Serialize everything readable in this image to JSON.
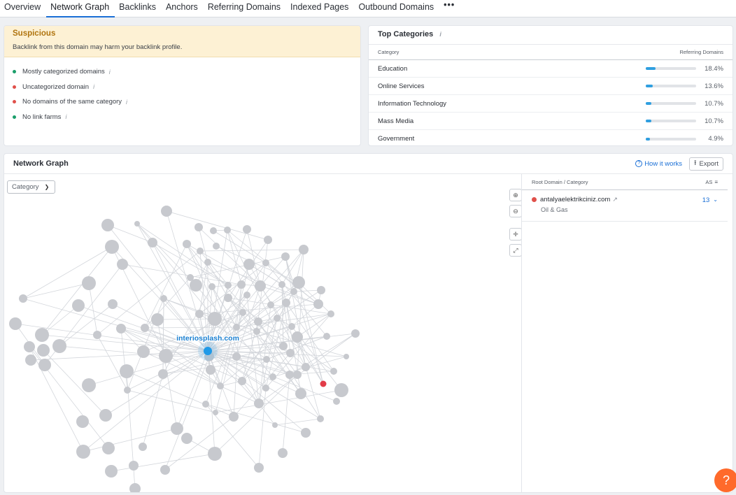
{
  "tabs": [
    {
      "label": "Overview",
      "active": false
    },
    {
      "label": "Network Graph",
      "active": true
    },
    {
      "label": "Backlinks",
      "active": false
    },
    {
      "label": "Anchors",
      "active": false
    },
    {
      "label": "Referring Domains",
      "active": false
    },
    {
      "label": "Indexed Pages",
      "active": false
    },
    {
      "label": "Outbound Domains",
      "active": false
    }
  ],
  "more_label": "•••",
  "suspicious": {
    "title": "Suspicious",
    "description": "Backlink from this domain may harm your backlink profile.",
    "items": [
      {
        "label": "Mostly categorized domains",
        "status_color": "#1a9e6a",
        "info": "i"
      },
      {
        "label": "Uncategorized domain",
        "status_color": "#e0504a",
        "info": "i"
      },
      {
        "label": "No domains of the same category",
        "status_color": "#e0504a",
        "info": "i"
      },
      {
        "label": "No link farms",
        "status_color": "#1a9e6a",
        "info": "i"
      }
    ]
  },
  "top_categories": {
    "title": "Top Categories",
    "info": "i",
    "col_category": "Category",
    "col_domains": "Referring Domains",
    "rows": [
      {
        "category": "Education",
        "percent": "18.4%",
        "fraction": 0.184
      },
      {
        "category": "Online Services",
        "percent": "13.6%",
        "fraction": 0.136
      },
      {
        "category": "Information Technology",
        "percent": "10.7%",
        "fraction": 0.107
      },
      {
        "category": "Mass Media",
        "percent": "10.7%",
        "fraction": 0.107
      },
      {
        "category": "Government",
        "percent": "4.9%",
        "fraction": 0.049
      }
    ]
  },
  "network_graph": {
    "title": "Network Graph",
    "how_it_works": "How it works",
    "export": "Export",
    "category_select": "Category",
    "center_label": "interiosplash.com",
    "colors": {
      "node": "#c7c9ce",
      "center": "#1f9ae8",
      "highlight": "#e23c48",
      "edge": "#d3d6db"
    }
  },
  "side_panel": {
    "col_domain": "Root Domain / Category",
    "col_as": "AS",
    "rows": [
      {
        "domain": "antalyaelektrikciniz.com",
        "category": "Oil & Gas",
        "as": "13",
        "status_color": "#e0504a"
      }
    ]
  },
  "help": "?"
}
